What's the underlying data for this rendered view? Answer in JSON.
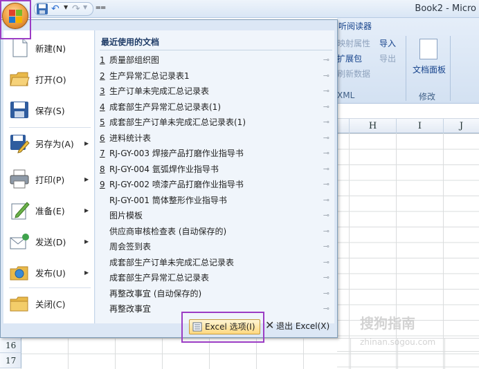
{
  "window": {
    "title": "Book2 - Micro"
  },
  "ribbon": {
    "tab": "听阅读器",
    "items": [
      "映射属性",
      "导入",
      "扩展包",
      "导出",
      "刷新数据"
    ],
    "group_xml": "XML",
    "doc_panel": "文档面板",
    "group_modify": "修改"
  },
  "columns": [
    "H",
    "I",
    "J"
  ],
  "rows": [
    "16",
    "17"
  ],
  "menu": {
    "commands": [
      {
        "label": "新建(N)",
        "icon": "new-document-icon",
        "submenu": false
      },
      {
        "label": "打开(O)",
        "icon": "open-folder-icon",
        "submenu": false
      },
      {
        "label": "保存(S)",
        "icon": "save-disk-icon",
        "submenu": false
      },
      {
        "label": "另存为(A)",
        "icon": "save-as-icon",
        "submenu": true
      },
      {
        "label": "打印(P)",
        "icon": "printer-icon",
        "submenu": true
      },
      {
        "label": "准备(E)",
        "icon": "prepare-icon",
        "submenu": true
      },
      {
        "label": "发送(D)",
        "icon": "send-icon",
        "submenu": true
      },
      {
        "label": "发布(U)",
        "icon": "publish-icon",
        "submenu": true
      },
      {
        "label": "关闭(C)",
        "icon": "close-folder-icon",
        "submenu": false
      }
    ],
    "recent_title": "最近使用的文档",
    "recent": [
      {
        "num": "1",
        "name": "质量部组织图"
      },
      {
        "num": "2",
        "name": "生产异常汇总记录表1"
      },
      {
        "num": "3",
        "name": "生产订单未完成汇总记录表"
      },
      {
        "num": "4",
        "name": "成套部生产异常汇总记录表(1)"
      },
      {
        "num": "5",
        "name": "成套部生产订单未完成汇总记录表(1)"
      },
      {
        "num": "6",
        "name": "进料统计表"
      },
      {
        "num": "7",
        "name": "RJ-GY-003 焊接产品打磨作业指导书"
      },
      {
        "num": "8",
        "name": "RJ-GY-004 氩弧焊作业指导书"
      },
      {
        "num": "9",
        "name": "RJ-GY-002 喷漆产品打磨作业指导书"
      },
      {
        "num": "",
        "name": "RJ-GY-001 筒体整形作业指导书"
      },
      {
        "num": "",
        "name": "图片模板"
      },
      {
        "num": "",
        "name": "供应商审核检查表 (自动保存的)"
      },
      {
        "num": "",
        "name": "周会签到表"
      },
      {
        "num": "",
        "name": "成套部生产订单未完成汇总记录表"
      },
      {
        "num": "",
        "name": "成套部生产异常汇总记录表"
      },
      {
        "num": "",
        "name": "再整改事宜 (自动保存的)"
      },
      {
        "num": "",
        "name": "再整改事宜"
      }
    ],
    "options_label": "Excel 选项(I)",
    "exit_label": "退出 Excel(X)"
  },
  "watermark": {
    "main": "搜狗指南",
    "sub": "zhinan.sogou.com"
  },
  "colors": {
    "highlight": "#9b3cc4",
    "menu_bg": "#dce7f5",
    "orb": "#f2a64a"
  }
}
